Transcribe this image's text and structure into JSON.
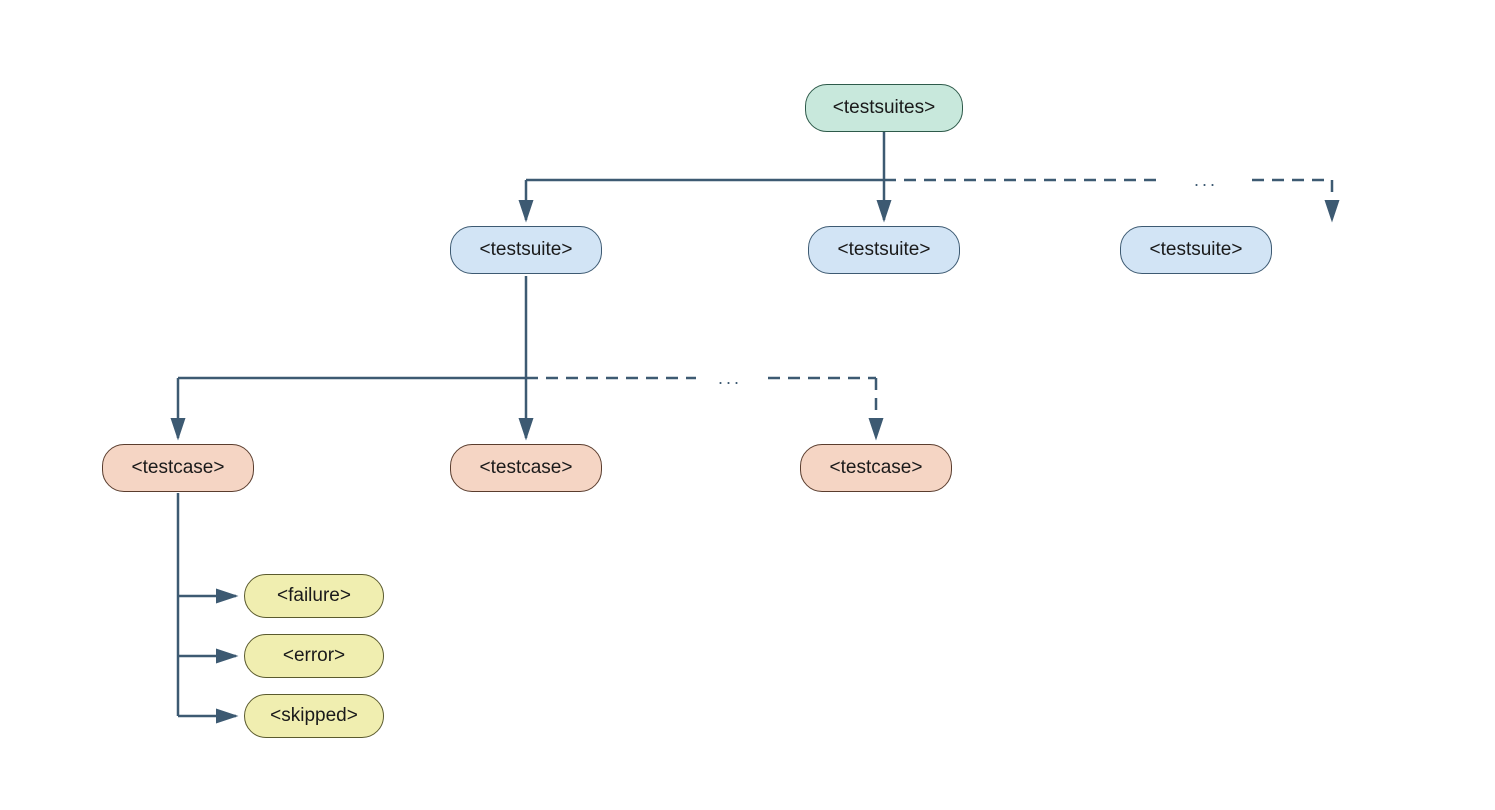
{
  "nodes": {
    "root": "<testsuites>",
    "suite1": "<testsuite>",
    "suite2": "<testsuite>",
    "suite3": "<testsuite>",
    "case1": "<testcase>",
    "case2": "<testcase>",
    "case3": "<testcase>",
    "failure": "<failure>",
    "error": "<error>",
    "skipped": "<skipped>"
  },
  "ellipsis1": "...",
  "ellipsis2": "..."
}
